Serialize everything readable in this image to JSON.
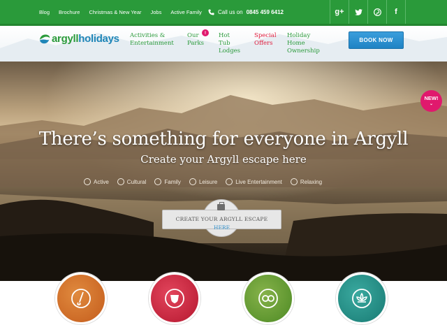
{
  "topbar": {
    "links": [
      "Blog",
      "Brochure",
      "Christmas & New Year",
      "Jobs",
      "Active Family"
    ],
    "phone_prefix": "Call us on",
    "phone_number": "0845 459 6412",
    "social": [
      {
        "icon": "google-plus-icon",
        "glyph": "g+"
      },
      {
        "icon": "twitter-icon",
        "glyph": "t"
      },
      {
        "icon": "pinterest-icon",
        "glyph": "p"
      },
      {
        "icon": "facebook-icon",
        "glyph": "f"
      }
    ]
  },
  "brand": {
    "logo_part1": "argyll",
    "logo_part2": "holidays"
  },
  "nav": {
    "items": [
      {
        "line1": "Activities &",
        "line2": "Entertainment"
      },
      {
        "line1": "Our",
        "line2": "Parks",
        "badge": "!"
      },
      {
        "line1": "Hot Tub",
        "line2": "Lodges"
      },
      {
        "line1": "Special",
        "line2": "Offers"
      },
      {
        "line1": "Holiday Home",
        "line2": "Ownership"
      }
    ],
    "book_label": "BOOK NOW"
  },
  "hero": {
    "title": "There’s something for everyone in Argyll",
    "subtitle": "Create your Argyll escape here",
    "new_badge": "NEW!",
    "categories": [
      "Active",
      "Cultural",
      "Family",
      "Leisure",
      "Live Entertainment",
      "Relaxing"
    ],
    "cta_line1": "CREATE YOUR ARGYLL ESCAPE",
    "cta_line2": "HERE"
  },
  "colors": {
    "green": "#2a9a3a",
    "blue": "#1f86b8",
    "pink": "#e0196d",
    "red": "#e0193a",
    "orange": "#d8722b",
    "crimson": "#d11f3c",
    "leaf": "#5a9a2b",
    "teal": "#1f8f87"
  }
}
